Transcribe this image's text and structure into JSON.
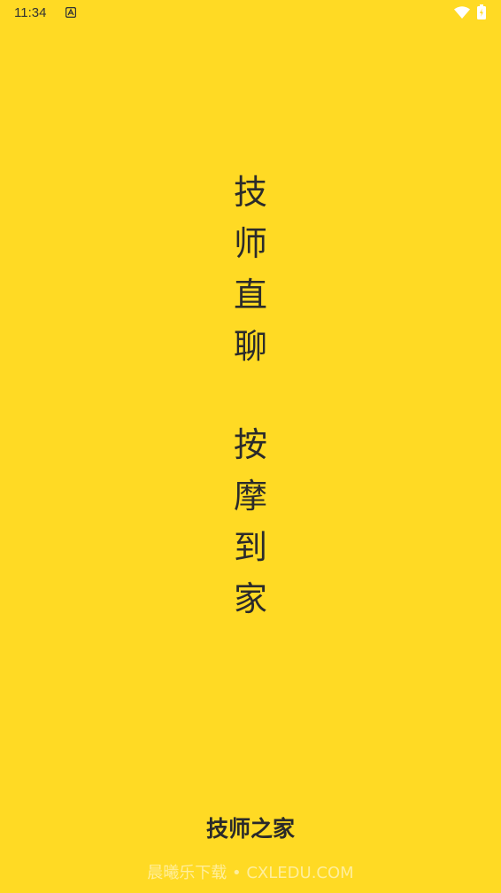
{
  "status_bar": {
    "time": "11:34",
    "icons": [
      "notification-a-icon",
      "wifi-icon",
      "battery-charging-icon"
    ]
  },
  "slogan": {
    "line1": [
      "技",
      "师",
      "直",
      "聊"
    ],
    "line2": [
      "按",
      "摩",
      "到",
      "家"
    ]
  },
  "app": {
    "name": "技师之家"
  },
  "watermark": {
    "text": "晨曦乐下载 • CXLEDU.COM"
  },
  "colors": {
    "background": "#FFDA24",
    "text": "#2a2a2a"
  }
}
